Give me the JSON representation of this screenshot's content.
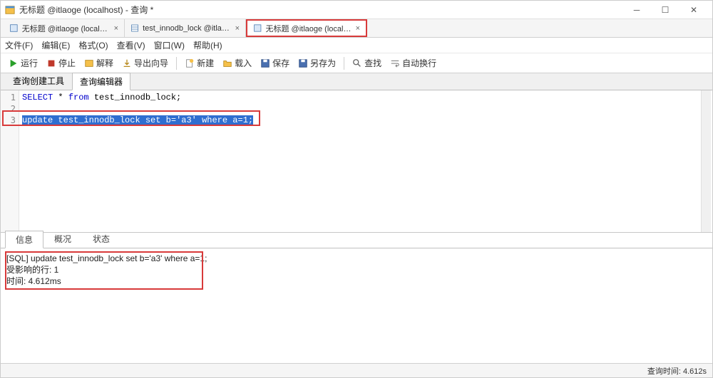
{
  "window": {
    "title": "无标题 @itlaoge (localhost) - 查询 *"
  },
  "tabs": [
    {
      "label": "无标题 @itlaoge (localh…",
      "active": false
    },
    {
      "label": "test_innodb_lock @itlaog…",
      "active": false
    },
    {
      "label": "无标题 @itlaoge (localh…",
      "active": true,
      "highlighted": true
    }
  ],
  "menu": {
    "file": "文件(F)",
    "edit": "编辑(E)",
    "format": "格式(O)",
    "view": "查看(V)",
    "window": "窗口(W)",
    "help": "帮助(H)"
  },
  "toolbar": {
    "run": "运行",
    "stop": "停止",
    "explain": "解释",
    "export": "导出向导",
    "new": "新建",
    "load": "载入",
    "save": "保存",
    "saveas": "另存为",
    "find": "查找",
    "autowrap": "自动换行"
  },
  "subtabs": {
    "builder": "查询创建工具",
    "editor": "查询编辑器"
  },
  "code": {
    "lines": [
      "1",
      "2",
      "3"
    ],
    "l1_a": "SELECT",
    "l1_b": " * ",
    "l1_c": "from",
    "l1_d": " test_innodb_lock;",
    "l3_a": "update",
    "l3_b": " test_innodb_lock ",
    "l3_c": "set",
    "l3_d": " b=",
    "l3_e": "'a3'",
    "l3_f": " where",
    "l3_g": " a=1;"
  },
  "resultTabs": {
    "info": "信息",
    "profile": "概况",
    "status": "状态"
  },
  "results": {
    "l1": "[SQL] update test_innodb_lock set b='a3' where a=1;",
    "l2": "受影响的行: 1",
    "l3": "时间: 4.612ms"
  },
  "status": {
    "queryTime": "查询时间: 4.612s"
  }
}
